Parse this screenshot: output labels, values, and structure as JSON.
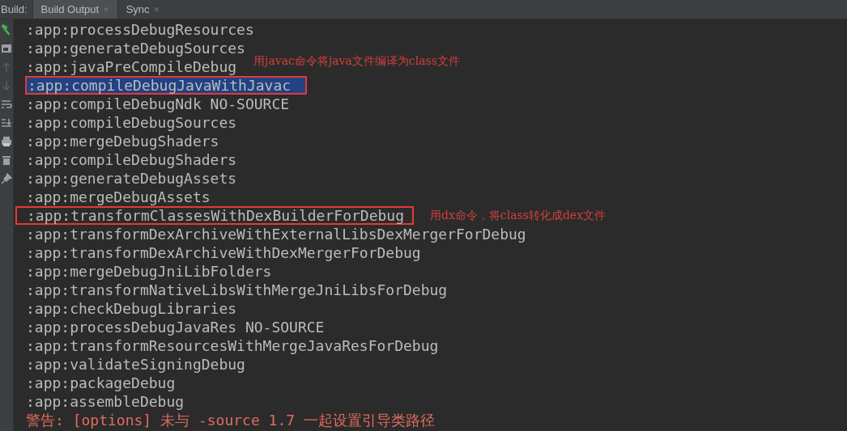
{
  "toolbar_label": "Build:",
  "tabs": [
    {
      "label": "Build Output",
      "close": "×",
      "selected": true
    },
    {
      "label": "Sync",
      "close": "×",
      "selected": false
    }
  ],
  "lines": [
    {
      "text": ":app:processDebugResources"
    },
    {
      "text": ":app:generateDebugSources"
    },
    {
      "text": ":app:javaPreCompileDebug",
      "note": "用javac命令将java文件编译为class文件"
    },
    {
      "text": ":app:compileDebugJavaWithJavac",
      "boxed": true,
      "selected": true
    },
    {
      "text": ":app:compileDebugNdk NO-SOURCE"
    },
    {
      "text": ":app:compileDebugSources"
    },
    {
      "text": ":app:mergeDebugShaders"
    },
    {
      "text": ":app:compileDebugShaders"
    },
    {
      "text": ":app:generateDebugAssets"
    },
    {
      "text": ":app:mergeDebugAssets"
    },
    {
      "text": ":app:transformClassesWithDexBuilderForDebug",
      "boxed": true,
      "note": "用dx命令，将class转化成dex文件"
    },
    {
      "text": ":app:transformDexArchiveWithExternalLibsDexMergerForDebug"
    },
    {
      "text": ":app:transformDexArchiveWithDexMergerForDebug"
    },
    {
      "text": ":app:mergeDebugJniLibFolders"
    },
    {
      "text": ":app:transformNativeLibsWithMergeJniLibsForDebug"
    },
    {
      "text": ":app:checkDebugLibraries"
    },
    {
      "text": ":app:processDebugJavaRes NO-SOURCE"
    },
    {
      "text": ":app:transformResourcesWithMergeJavaResForDebug"
    },
    {
      "text": ":app:validateSigningDebug"
    },
    {
      "text": ":app:packageDebug"
    },
    {
      "text": ":app:assembleDebug"
    },
    {
      "text": "警告: [options] 未与 -source 1.7 一起设置引导类路径",
      "kind": "warning"
    }
  ]
}
